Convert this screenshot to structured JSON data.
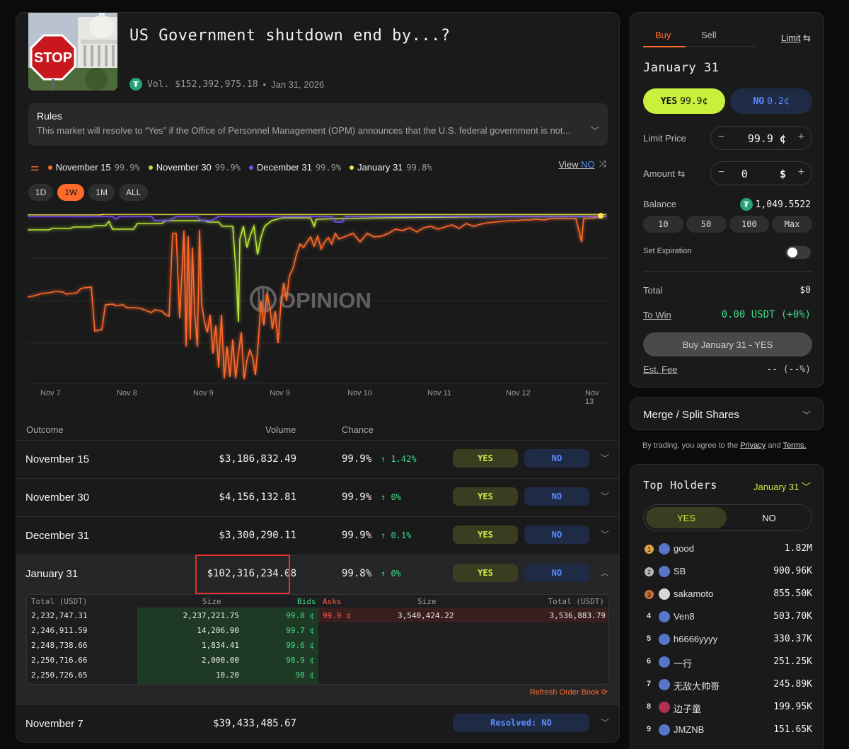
{
  "market": {
    "title": "US Government shutdown end by...?",
    "volume": "Vol. $152,392,975.18",
    "date": "Jan 31, 2026",
    "rules_heading": "Rules",
    "rules_text": "This market will resolve to “Yes” if the Office of Personnel Management (OPM) announces that the U.S. federal government is not..."
  },
  "legend": [
    {
      "label": "November 15",
      "pct": "99.9%",
      "color": "#ff6a2b"
    },
    {
      "label": "November 30",
      "pct": "99.9%",
      "color": "#b6e534"
    },
    {
      "label": "December 31",
      "pct": "99.9%",
      "color": "#7c4dff"
    },
    {
      "label": "January 31",
      "pct": "99.8%",
      "color": "#ffe14a"
    }
  ],
  "view": {
    "prefix": "View",
    "no": "NO"
  },
  "ranges": [
    "1D",
    "1W",
    "1M",
    "ALL"
  ],
  "active_range": "1W",
  "watermark": "OPINION",
  "x_ticks": [
    "Nov 7",
    "Nov 8",
    "Nov 9",
    "Nov 9",
    "Nov 10",
    "Nov 11",
    "Nov 12",
    "Nov 13"
  ],
  "table": {
    "headers": {
      "outcome": "Outcome",
      "volume": "Volume",
      "chance": "Chance"
    },
    "rows": [
      {
        "name": "November 15",
        "volume": "$3,186,832.49",
        "chance": "99.9%",
        "change": "↑ 1.42%",
        "yes": "YES",
        "no": "NO"
      },
      {
        "name": "November 30",
        "volume": "$4,156,132.81",
        "chance": "99.9%",
        "change": "↑ 0%",
        "yes": "YES",
        "no": "NO"
      },
      {
        "name": "December 31",
        "volume": "$3,300,290.11",
        "chance": "99.9%",
        "change": "↑ 0.1%",
        "yes": "YES",
        "no": "NO"
      },
      {
        "name": "January 31",
        "volume": "$102,316,234.08",
        "chance": "99.8%",
        "change": "↑ 0%",
        "yes": "YES",
        "no": "NO"
      }
    ],
    "resolved_row": {
      "name": "November 7",
      "volume": "$39,433,485.67",
      "status": "Resolved: NO"
    }
  },
  "orderbook": {
    "headers": {
      "total": "Total (USDT)",
      "size": "Size",
      "bids": "Bids",
      "asks": "Asks",
      "ask_size": "Size",
      "ask_total": "Total (USDT)"
    },
    "bids": [
      {
        "total": "2,232,747.31",
        "size": "2,237,221.75",
        "price": "99.8 ¢"
      },
      {
        "total": "2,246,911.59",
        "size": "14,206.90",
        "price": "99.7 ¢"
      },
      {
        "total": "2,248,738.66",
        "size": "1,834.41",
        "price": "99.6 ¢"
      },
      {
        "total": "2,250,716.66",
        "size": "2,000.00",
        "price": "98.9 ¢"
      },
      {
        "total": "2,250,726.65",
        "size": "10.20",
        "price": "98 ¢"
      }
    ],
    "asks": [
      {
        "price": "99.9 ¢",
        "size": "3,540,424.22",
        "total": "3,536,883.79"
      }
    ],
    "refresh": "Refresh Order Book"
  },
  "trade": {
    "tab_buy": "Buy",
    "tab_sell": "Sell",
    "order_type": "Limit",
    "outcome": "January 31",
    "yes_label": "YES",
    "yes_price": "99.9¢",
    "no_label": "NO",
    "no_price": "0.2¢",
    "limit_price_label": "Limit Price",
    "limit_price": "99.9",
    "limit_unit": "¢",
    "amount_label": "Amount",
    "amount": "0",
    "amount_unit": "$",
    "balance_label": "Balance",
    "balance": "1,049.5522",
    "quick": [
      "10",
      "50",
      "100",
      "Max"
    ],
    "expiration_label": "Set Expiration",
    "total_label": "Total",
    "total": "$0",
    "towin_label": "To Win",
    "towin": "0.00 USDT (+0%)",
    "buy_button": "Buy January 31 - YES",
    "fee_label": "Est. Fee",
    "fee": "-- (--%)"
  },
  "merge": {
    "label": "Merge / Split Shares"
  },
  "agree": {
    "prefix": "By trading, you agree to the",
    "privacy": "Privacy",
    "and": "and",
    "terms": "Terms."
  },
  "holders": {
    "title": "Top Holders",
    "outcome": "January 31",
    "yes_tab": "YES",
    "no_tab": "NO",
    "list": [
      {
        "rank": "1",
        "name": "good",
        "amount": "1.82M"
      },
      {
        "rank": "2",
        "name": "SB",
        "amount": "900.96K"
      },
      {
        "rank": "3",
        "name": "sakamoto",
        "amount": "855.50K"
      },
      {
        "rank": "4",
        "name": "Ven8",
        "amount": "503.70K"
      },
      {
        "rank": "5",
        "name": "h6666yyyy",
        "amount": "330.37K"
      },
      {
        "rank": "6",
        "name": "一行",
        "amount": "251.25K"
      },
      {
        "rank": "7",
        "name": "无敌大帅哥",
        "amount": "245.89K"
      },
      {
        "rank": "8",
        "name": "边子童",
        "amount": "199.95K"
      },
      {
        "rank": "9",
        "name": "JMZNB",
        "amount": "151.65K"
      }
    ]
  }
}
